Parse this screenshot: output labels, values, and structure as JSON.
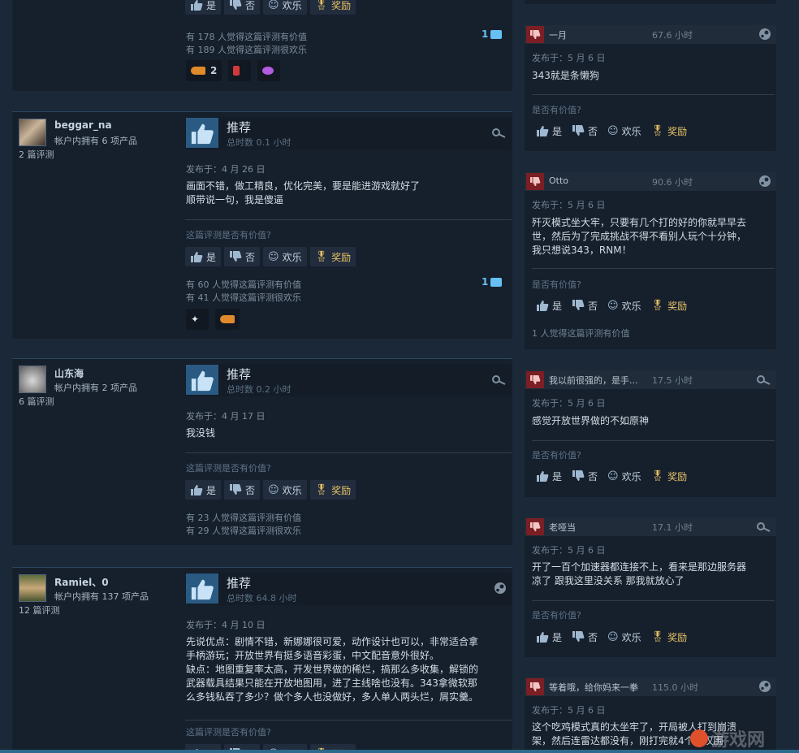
{
  "labels": {
    "yes": "是",
    "no": "否",
    "funny": "欢乐",
    "award": "奖励",
    "helpful_question": "这篇评测是否有价值?",
    "r_helpful_question": "是否有价值?",
    "recommended": "推荐"
  },
  "top_review": {
    "stat_helpful": "有 178 人觉得这篇评测有价值",
    "stat_funny": "有 189 人觉得这篇评测很欢乐",
    "comments": "1",
    "awards": [
      {
        "icon": "hand-point-award-icon",
        "count": "2"
      },
      {
        "icon": "red-award-icon",
        "count": ""
      },
      {
        "icon": "purple-award-icon",
        "count": ""
      }
    ]
  },
  "reviews": [
    {
      "name": "beggar_na",
      "products": "帐户内拥有 6 项产品",
      "review_count": "2 篇评测",
      "hours": "总时数 0.1 小时",
      "posted": "发布于：4 月 26 日",
      "content": [
        "画面不错，做工精良，优化完美，要是能进游戏就好了",
        "顺带说一句，我是傻逼"
      ],
      "stat_helpful": "有 60 人觉得这篇评测有价值",
      "stat_funny": "有 41 人觉得这篇评测很欢乐",
      "comments": "1",
      "awards": [
        {
          "icon": "wings-award-icon",
          "count": ""
        },
        {
          "icon": "hand-point-award-icon",
          "count": ""
        }
      ]
    },
    {
      "name": "山东海",
      "products": "帐户内拥有 2 项产品",
      "review_count": "6 篇评测",
      "hours": "总时数 0.2 小时",
      "posted": "发布于：4 月 17 日",
      "content": [
        "我没钱"
      ],
      "stat_helpful": "有 23 人觉得这篇评测有价值",
      "stat_funny": "有 29 人觉得这篇评测很欢乐"
    },
    {
      "name": "Ramiel、0",
      "products": "帐户内拥有 137 项产品",
      "review_count": "12 篇评测",
      "hours": "总时数 64.8 小时",
      "posted": "发布于：4 月 10 日",
      "content": [
        "先说优点：剧情不错，新娜娜很可爱，动作设计也可以，非常适合拿",
        "手柄游玩；开放世界有挺多语音彩蛋，中文配音意外很好。",
        "缺点：地图重复率太高，开发世界做的稀烂，搞那么多收集，解锁的",
        "武器载具结果只能在开放地图用，进了主线啥也没有。343拿微软那",
        "么多钱私吞了多少？做个多人也没做好，多人单人两头烂，屑实羹。"
      ]
    }
  ],
  "right_reviews": [
    {
      "name": "一月",
      "hours": "67.6 小时",
      "posted": "发布于：5 月 6 日",
      "content": [
        "343就是条懒狗"
      ],
      "stat": ""
    },
    {
      "name": "Otto",
      "hours": "90.6 小时",
      "posted": "发布于：5 月 6 日",
      "content": [
        "歼灭模式坐大牢，只要有几个打的好的你就早早去",
        "世，然后为了完成挑战不得不看别人玩个十分钟，",
        "我只想说343，RNM！"
      ],
      "stat": "1 人觉得这篇评测有价值"
    },
    {
      "name": "我以前很强的，是手...",
      "hours": "17.5 小时",
      "posted": "发布于：5 月 6 日",
      "content": [
        "感觉开放世界做的不如原神"
      ],
      "stat": ""
    },
    {
      "name": "老哑当",
      "hours": "17.1 小时",
      "posted": "发布于：5 月 6 日",
      "content": [
        "开了一百个加速器都连接不上，看来是那边服务器",
        "凉了 跟我这里没关系 那我就放心了"
      ],
      "stat": ""
    },
    {
      "name": "等着哦，给你妈来一拳",
      "hours": "115.0 小时",
      "posted": "发布于：5 月 6 日",
      "content": [
        "这个吃鸡模式真的太坐牢了，开局被人打到崩溃",
        "架，然后连雷达都没有，刚打完就4个大汉围"
      ],
      "stat": ""
    }
  ],
  "watermark": "游戏网"
}
